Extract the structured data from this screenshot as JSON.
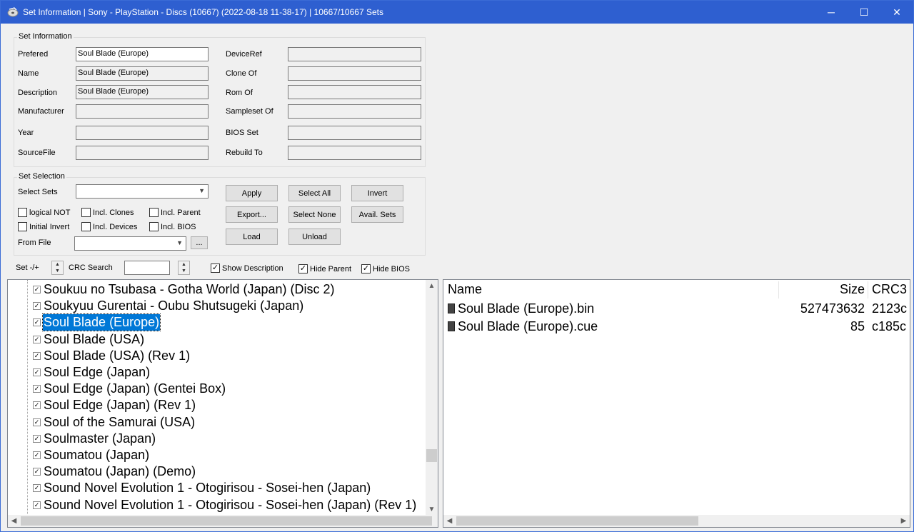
{
  "window": {
    "title": "Set Information | Sony - PlayStation - Discs (10667) (2022-08-18 11-38-17) | 10667/10667 Sets",
    "minimize": "─",
    "maximize": "☐",
    "close": "✕"
  },
  "set_information": {
    "title": "Set Information",
    "left_fields": [
      {
        "label": "Prefered",
        "value": "Soul Blade (Europe)"
      },
      {
        "label": "Name",
        "value": "Soul Blade (Europe)"
      },
      {
        "label": "Description",
        "value": "Soul Blade (Europe)"
      },
      {
        "label": "Manufacturer",
        "value": ""
      },
      {
        "label": "Year",
        "value": ""
      },
      {
        "label": "SourceFile",
        "value": ""
      }
    ],
    "right_fields": [
      {
        "label": "DeviceRef",
        "value": ""
      },
      {
        "label": "Clone Of",
        "value": ""
      },
      {
        "label": "Rom Of",
        "value": ""
      },
      {
        "label": "Sampleset Of",
        "value": ""
      },
      {
        "label": "BIOS Set",
        "value": ""
      },
      {
        "label": "Rebuild To",
        "value": ""
      }
    ]
  },
  "set_selection": {
    "title": "Set Selection",
    "select_sets_label": "Select Sets",
    "select_sets_value": "",
    "from_file_label": "From File",
    "from_file_value": "",
    "browse_label": "...",
    "checkboxes": [
      {
        "label": "logical NOT",
        "checked": false
      },
      {
        "label": "Incl. Clones",
        "checked": false
      },
      {
        "label": "Incl. Parent",
        "checked": false
      },
      {
        "label": "Initial Invert",
        "checked": false
      },
      {
        "label": "Incl. Devices",
        "checked": false
      },
      {
        "label": "Incl. BIOS",
        "checked": false
      }
    ],
    "buttons": {
      "apply": "Apply",
      "select_all": "Select All",
      "invert": "Invert",
      "export": "Export...",
      "select_none": "Select None",
      "avail_sets": "Avail. Sets",
      "load": "Load",
      "unload": "Unload"
    }
  },
  "toolbar": {
    "set_label": "Set -/+",
    "crc_label": "CRC Search",
    "crc_value": "",
    "show_description": {
      "label": "Show Description",
      "checked": true
    },
    "hide_parent": {
      "label": "Hide Parent",
      "checked": true
    },
    "hide_bios": {
      "label": "Hide BIOS",
      "checked": true
    }
  },
  "set_list": {
    "items": [
      {
        "label": "Soukuu no Tsubasa - Gotha World (Japan) (Disc 2)",
        "checked": true,
        "selected": false
      },
      {
        "label": "Soukyuu Gurentai - Oubu Shutsugeki (Japan)",
        "checked": true,
        "selected": false
      },
      {
        "label": "Soul Blade (Europe)",
        "checked": true,
        "selected": true
      },
      {
        "label": "Soul Blade (USA)",
        "checked": true,
        "selected": false
      },
      {
        "label": "Soul Blade (USA) (Rev 1)",
        "checked": true,
        "selected": false
      },
      {
        "label": "Soul Edge (Japan)",
        "checked": true,
        "selected": false
      },
      {
        "label": "Soul Edge (Japan) (Gentei Box)",
        "checked": true,
        "selected": false
      },
      {
        "label": "Soul Edge (Japan) (Rev 1)",
        "checked": true,
        "selected": false
      },
      {
        "label": "Soul of the Samurai (USA)",
        "checked": true,
        "selected": false
      },
      {
        "label": "Soulmaster (Japan)",
        "checked": true,
        "selected": false
      },
      {
        "label": "Soumatou (Japan)",
        "checked": true,
        "selected": false
      },
      {
        "label": "Soumatou (Japan) (Demo)",
        "checked": true,
        "selected": false
      },
      {
        "label": "Sound Novel Evolution 1 - Otogirisou - Sosei-hen (Japan)",
        "checked": true,
        "selected": false
      },
      {
        "label": "Sound Novel Evolution 1 - Otogirisou - Sosei-hen (Japan) (Rev 1)",
        "checked": true,
        "selected": false
      }
    ]
  },
  "file_list": {
    "columns": {
      "name": "Name",
      "size": "Size",
      "crc": "CRC3"
    },
    "rows": [
      {
        "name": "Soul Blade (Europe).bin",
        "size": "527473632",
        "crc": "2123c"
      },
      {
        "name": "Soul Blade (Europe).cue",
        "size": "85",
        "crc": "c185c"
      }
    ]
  }
}
